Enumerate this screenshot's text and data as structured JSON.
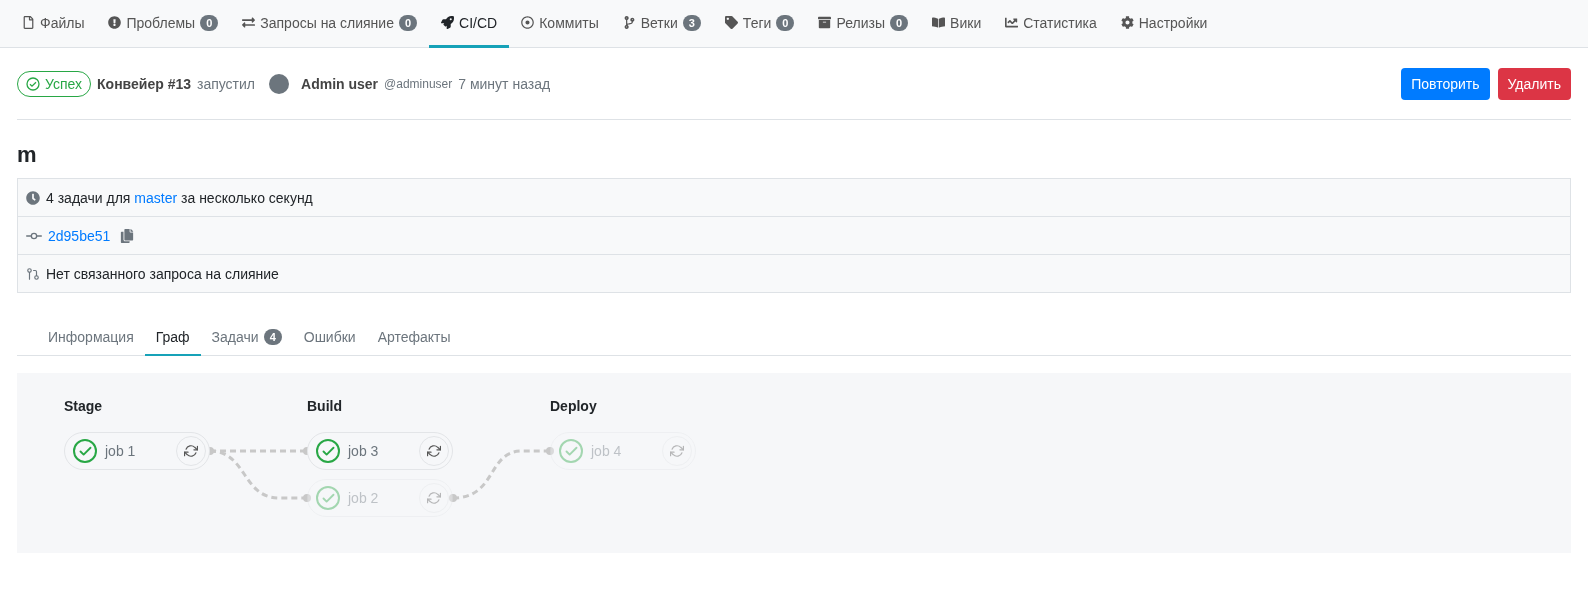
{
  "nav": [
    {
      "label": "Файлы",
      "selected": false
    },
    {
      "label": "Проблемы",
      "count": "0",
      "selected": false
    },
    {
      "label": "Запросы на слияние",
      "count": "0",
      "selected": false
    },
    {
      "label": "CI/CD",
      "selected": true
    },
    {
      "label": "Коммиты",
      "selected": false
    },
    {
      "label": "Ветки",
      "count": "3",
      "selected": false
    },
    {
      "label": "Теги",
      "count": "0",
      "selected": false
    },
    {
      "label": "Релизы",
      "count": "0",
      "selected": false
    },
    {
      "label": "Вики",
      "selected": false
    },
    {
      "label": "Статистика",
      "selected": false
    },
    {
      "label": "Настройки",
      "selected": false
    }
  ],
  "pipeline": {
    "status": "Успех",
    "name": "Конвейер #13",
    "started_by": "запустил",
    "user": "Admin user",
    "handle": "@adminuser",
    "time": "7 минут назад"
  },
  "buttons": [
    {
      "label": "Повторить",
      "kind": "primary"
    },
    {
      "label": "Удалить",
      "kind": "danger"
    }
  ],
  "title": "m",
  "info": {
    "jobs_before": "4 задачи для ",
    "branch": "master",
    "jobs_after": " за несколько секунд",
    "commit": "2d95be51",
    "merge_request": "Нет связанного запроса на слияние"
  },
  "subtabs": [
    {
      "label": "Информация",
      "selected": false
    },
    {
      "label": "Граф",
      "selected": true
    },
    {
      "label": "Задачи",
      "count": "4",
      "selected": false
    },
    {
      "label": "Ошибки",
      "selected": false
    },
    {
      "label": "Артефакты",
      "selected": false
    }
  ],
  "stages": [
    {
      "title": "Stage",
      "jobs": [
        {
          "name": "job 1",
          "faded": false
        }
      ]
    },
    {
      "title": "Build",
      "jobs": [
        {
          "name": "job 3",
          "faded": false
        },
        {
          "name": "job 2",
          "faded": true
        }
      ]
    },
    {
      "title": "Deploy",
      "jobs": [
        {
          "name": "job 4",
          "faded": true
        }
      ]
    }
  ]
}
